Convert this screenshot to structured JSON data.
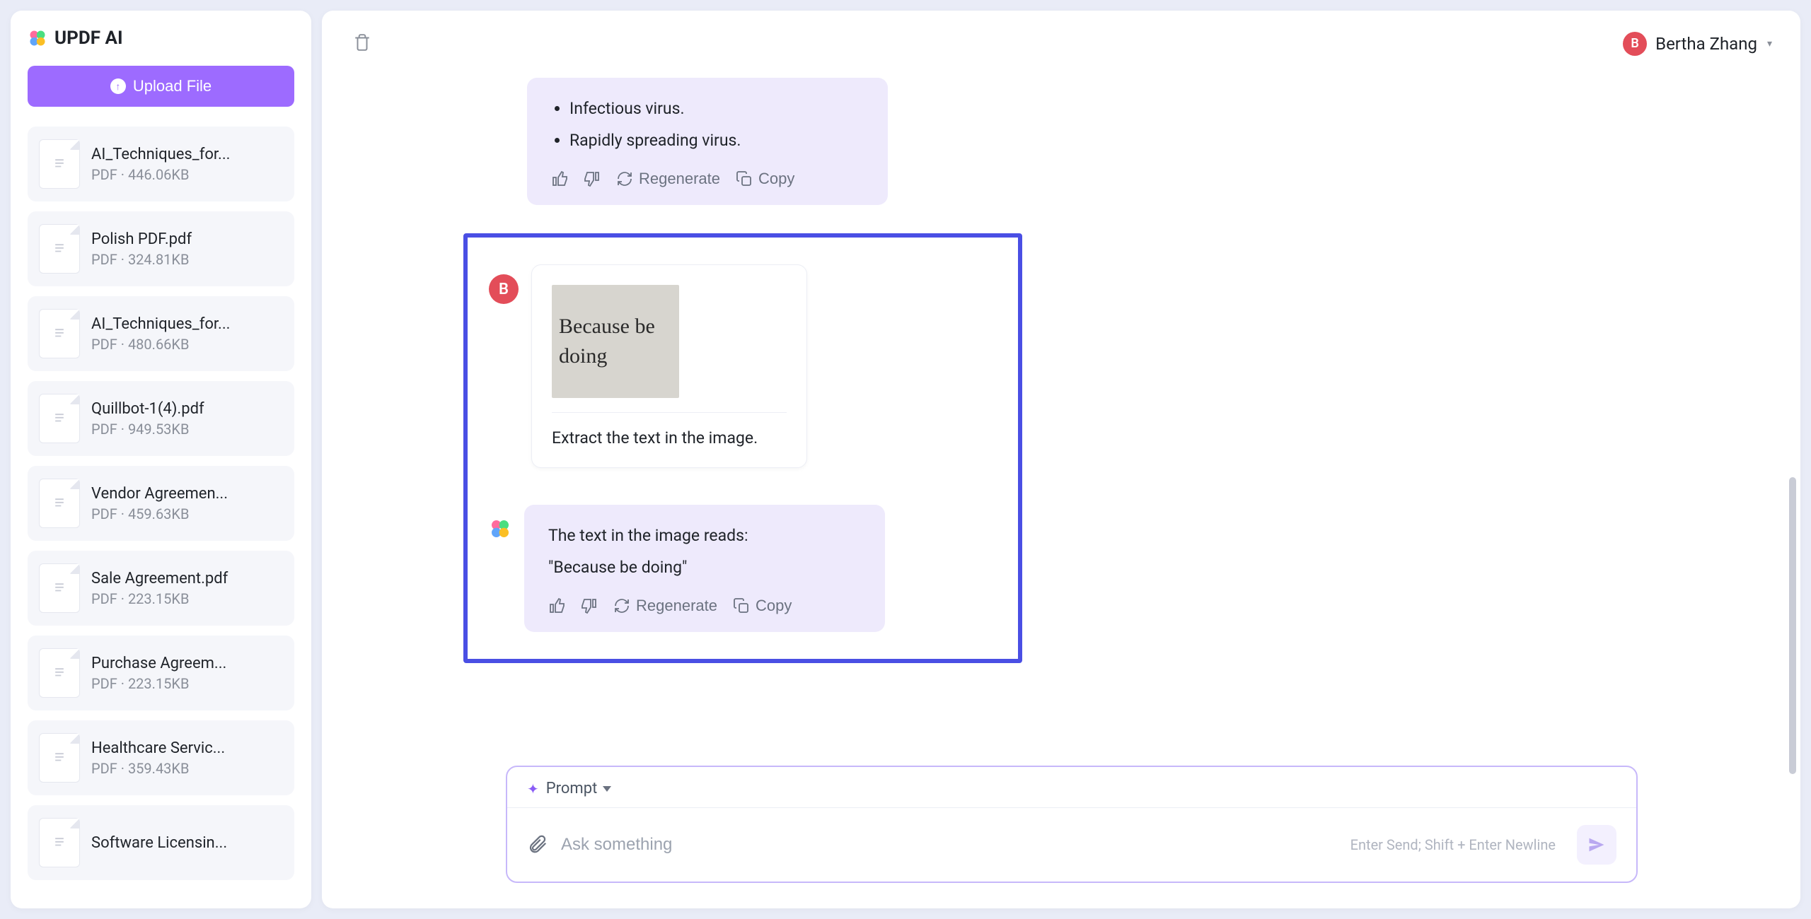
{
  "app": {
    "title": "UPDF AI"
  },
  "upload_button": "Upload File",
  "user": {
    "name": "Bertha Zhang",
    "initial": "B"
  },
  "files": [
    {
      "name": "AI_Techniques_for...",
      "meta": "PDF · 446.06KB"
    },
    {
      "name": "Polish PDF.pdf",
      "meta": "PDF · 324.81KB"
    },
    {
      "name": "AI_Techniques_for...",
      "meta": "PDF · 480.66KB"
    },
    {
      "name": "Quillbot-1(4).pdf",
      "meta": "PDF · 949.53KB"
    },
    {
      "name": "Vendor Agreemen...",
      "meta": "PDF · 459.63KB"
    },
    {
      "name": "Sale Agreement.pdf",
      "meta": "PDF · 223.15KB"
    },
    {
      "name": "Purchase Agreem...",
      "meta": "PDF · 223.15KB"
    },
    {
      "name": "Healthcare Servic...",
      "meta": "PDF · 359.43KB"
    },
    {
      "name": "Software Licensin...",
      "meta": ""
    }
  ],
  "prev_ai": {
    "bullets": [
      "Infectious virus.",
      "Rapidly spreading virus."
    ]
  },
  "user_msg": {
    "image_text": "Because be doing",
    "prompt": "Extract the text in the image."
  },
  "ai_msg": {
    "line1": "The text in the image reads:",
    "line2": "\"Because be doing\""
  },
  "actions": {
    "regenerate": "Regenerate",
    "copy": "Copy"
  },
  "prompt_bar": {
    "label": "Prompt",
    "placeholder": "Ask something",
    "hint": "Enter Send; Shift + Enter Newline"
  }
}
